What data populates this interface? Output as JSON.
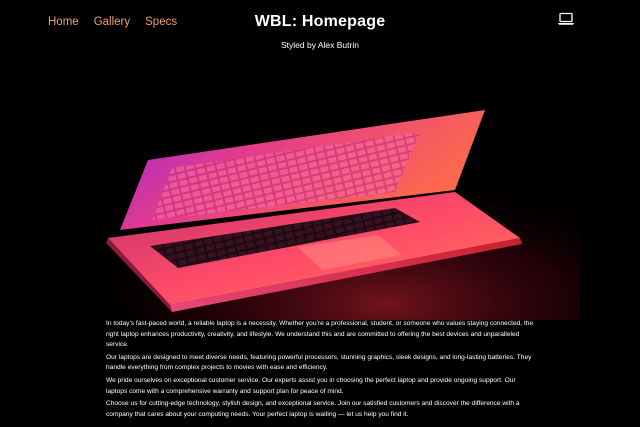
{
  "nav": {
    "items": [
      {
        "label": "Home"
      },
      {
        "label": "Gallery"
      },
      {
        "label": "Specs"
      }
    ]
  },
  "header": {
    "title": "WBL: Homepage",
    "subtitle": "Styled by Alex Butrin",
    "logo_icon": "laptop-icon"
  },
  "colors": {
    "background": "#000000",
    "nav_link": "#f0a06c",
    "text": "#ffffff",
    "accent_pink": "#e0307a",
    "accent_red": "#d01020"
  },
  "content": {
    "paragraphs": [
      "In today’s fast-paced world, a reliable laptop is a necessity. Whether you’re a professional, student, or someone who values staying connected, the right laptop enhances productivity, creativity, and lifestyle. We understand this and are committed to offering the best devices and unparalleled service.",
      "Our laptops are designed to meet diverse needs, featuring powerful processors, stunning graphics, sleek designs, and long-lasting batteries. They handle everything from complex projects to movies with ease and efficiency.",
      "We pride ourselves on exceptional customer service. Our experts assist you in choosing the perfect laptop and provide ongoing support. Our laptops come with a comprehensive warranty and support plan for peace of mind.",
      "Choose us for cutting-edge technology, stylish design, and exceptional service. Join our satisfied customers and discover the difference with a company that cares about your computing needs. Your perfect laptop is waiting — let us help you find it."
    ]
  }
}
